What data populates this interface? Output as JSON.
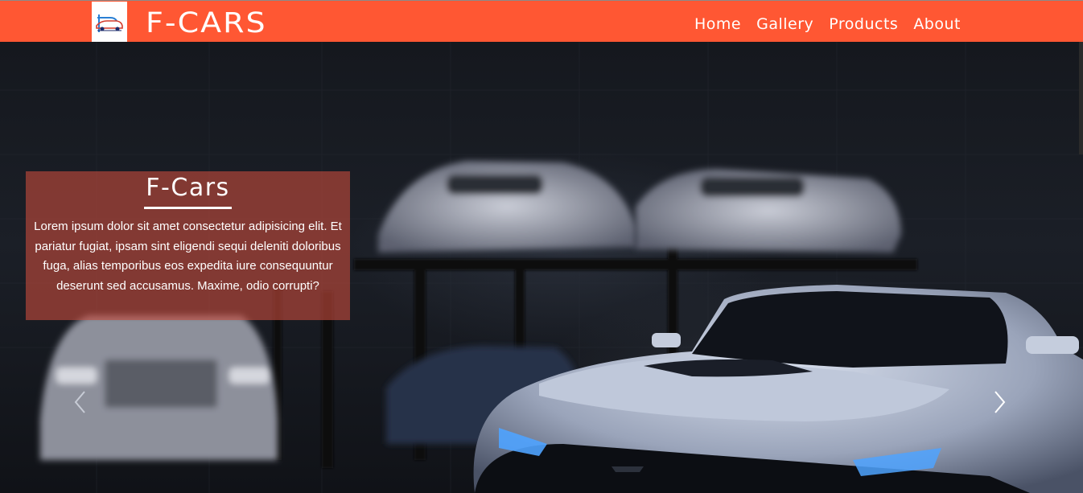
{
  "navbar": {
    "brand": "F-CARS",
    "logo_icon": "car-logo-icon",
    "links": [
      "Home",
      "Gallery",
      "Products",
      "About"
    ],
    "background_color": "#ff5733"
  },
  "carousel": {
    "caption": {
      "title": "F-Cars",
      "text": "Lorem ipsum dolor sit amet consectetur adipisicing elit. Et pariatur fugiat, ipsam sint eligendi sequi deleniti doloribus fuga, alias temporibus eos expedita iure consequuntur deserunt sed accusamus. Maxime, odio corrupti?"
    },
    "prev_icon": "chevron-left-icon",
    "next_icon": "chevron-right-icon"
  }
}
